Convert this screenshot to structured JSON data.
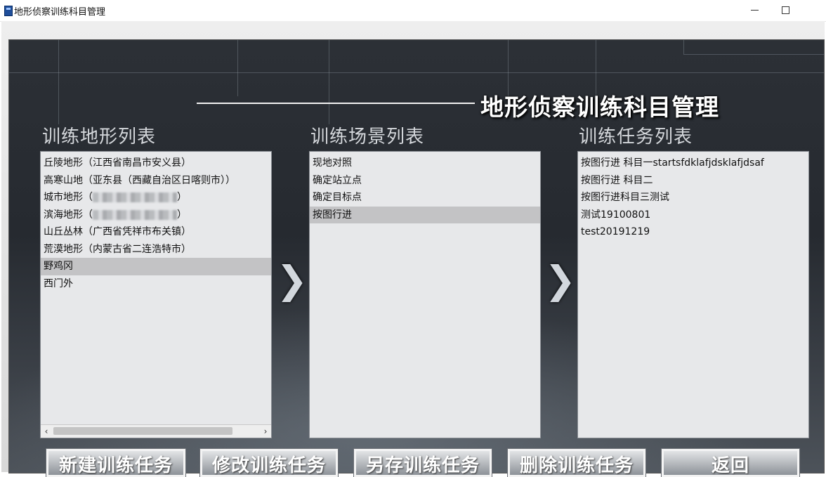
{
  "window": {
    "title": "地形侦察训练科目管理",
    "min_icon": "minimize-icon",
    "max_icon": "maximize-icon"
  },
  "heading": "地形侦察训练科目管理",
  "terrain_list": {
    "label": "训练地形列表",
    "items": [
      {
        "text": "丘陵地形（江西省南昌市安义县）"
      },
      {
        "text": "高寒山地（亚东县（西藏自治区日喀则市））"
      },
      {
        "text": "城市地形（",
        "suffix": "）",
        "redacted": true
      },
      {
        "text": "滨海地形（",
        "suffix": "）",
        "redacted": true
      },
      {
        "text": "山丘丛林（广西省凭祥市布关镇）"
      },
      {
        "text": "荒漠地形（内蒙古省二连浩特市）"
      },
      {
        "text": "野鸡冈",
        "selected": true
      },
      {
        "text": "西门外"
      }
    ],
    "scroll_left": "‹",
    "scroll_right": "›"
  },
  "scene_list": {
    "label": "训练场景列表",
    "items": [
      {
        "text": "现地对照"
      },
      {
        "text": "确定站立点"
      },
      {
        "text": "确定目标点"
      },
      {
        "text": "按图行进",
        "selected": true
      }
    ]
  },
  "task_list": {
    "label": "训练任务列表",
    "items": [
      {
        "text": "按图行进 科目一startsfdklafjdsklafjdsaf"
      },
      {
        "text": "按图行进 科目二"
      },
      {
        "text": "按图行进科目三测试"
      },
      {
        "text": "测试19100801"
      },
      {
        "text": "test20191219"
      }
    ]
  },
  "chevron_glyph": "❯",
  "buttons": {
    "new_task": "新建训练任务",
    "edit_task": "修改训练任务",
    "save_as_task": "另存训练任务",
    "delete_task": "删除训练任务",
    "back": "返回"
  },
  "colors": {
    "background_dark": "#2c3036",
    "list_bg": "#e7e8ea",
    "selected_row": "#c3c3c5",
    "label_text": "#d4d7db"
  }
}
